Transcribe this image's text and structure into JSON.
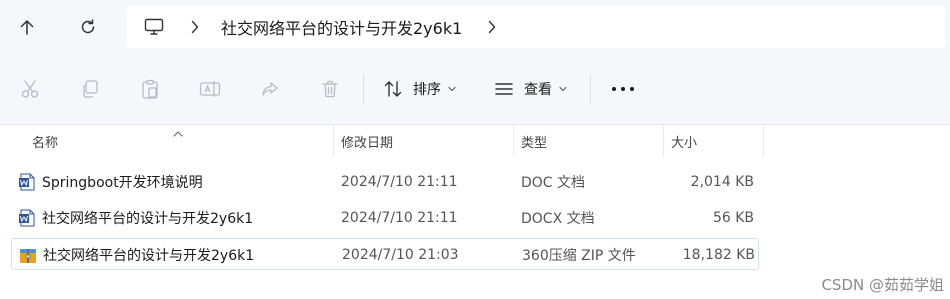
{
  "address_bar": {
    "path_segment": "社交网络平台的设计与开发2y6k1"
  },
  "toolbar": {
    "sort_label": "排序",
    "view_label": "查看"
  },
  "columns": {
    "name": "名称",
    "modified": "修改日期",
    "type": "类型",
    "size": "大小"
  },
  "files": [
    {
      "name": "Springboot开发环境说明",
      "modified": "2024/7/10 21:11",
      "type": "DOC 文档",
      "size": "2,014 KB",
      "icon": "word-doc-icon"
    },
    {
      "name": "社交网络平台的设计与开发2y6k1",
      "modified": "2024/7/10 21:11",
      "type": "DOCX 文档",
      "size": "56 KB",
      "icon": "word-docx-icon"
    },
    {
      "name": "社交网络平台的设计与开发2y6k1",
      "modified": "2024/7/10 21:03",
      "type": "360压缩 ZIP 文件",
      "size": "18,182 KB",
      "icon": "zip-archive-icon"
    }
  ],
  "watermark": "CSDN @茹茹学姐",
  "colors": {
    "bar_bg": "#f5f7fa",
    "selection_border": "#cfe3f4",
    "word_blue": "#2b579a",
    "zip_orange": "#e8a317"
  }
}
